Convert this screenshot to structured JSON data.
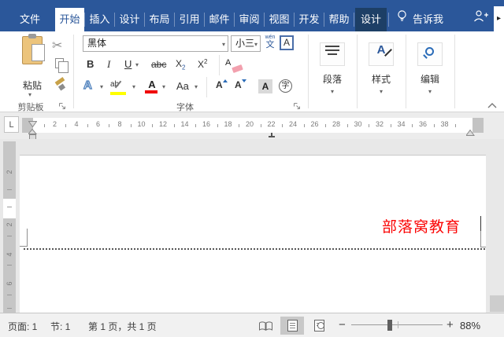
{
  "tabs": [
    {
      "label": "文件"
    },
    {
      "label": "开始"
    },
    {
      "label": "插入"
    },
    {
      "label": "设计"
    },
    {
      "label": "布局"
    },
    {
      "label": "引用"
    },
    {
      "label": "邮件"
    },
    {
      "label": "审阅"
    },
    {
      "label": "视图"
    },
    {
      "label": "开发"
    },
    {
      "label": "帮助"
    },
    {
      "label": "设计"
    }
  ],
  "tell_me": "告诉我",
  "expand_arrow": "▸",
  "ribbon": {
    "paste_label": "粘贴",
    "clipboard_group": "剪贴板",
    "font_group": "字体",
    "font_name": "黑体",
    "font_size": "小三",
    "bold": "B",
    "italic": "I",
    "underline": "U",
    "strikethrough": "abc",
    "sub_x": "X",
    "sub_2": "2",
    "sup_x": "X",
    "sup_2": "2",
    "clear_format": "A",
    "text_effects": "A",
    "highlight": "ab",
    "font_color": "A",
    "change_case": "Aa",
    "grow_font": "A",
    "shrink_font": "A",
    "char_shading": "A",
    "enclose_char": "字",
    "phonetic_top": "wén",
    "phonetic_char": "文",
    "char_border": "A",
    "paragraph": "段落",
    "styles": "样式",
    "styles_a": "A",
    "editing": "编辑",
    "dropdown": "▾"
  },
  "ruler": {
    "tab_selector": "L",
    "numbers": [
      "2",
      "4",
      "6",
      "8",
      "10",
      "12",
      "14",
      "16",
      "18",
      "20",
      "22",
      "24",
      "26",
      "28",
      "30",
      "32",
      "34",
      "36",
      "38"
    ],
    "vertical_numbers": [
      "2",
      "2",
      "4",
      "6"
    ]
  },
  "document": {
    "header_text": "部落窝教育"
  },
  "status": {
    "page": "页面: 1",
    "section": "节: 1",
    "page_of": "第 1 页，共 1 页",
    "zoom_out": "−",
    "zoom_in": "+",
    "zoom": "88%"
  },
  "colors": {
    "accent": "#2b579a",
    "contextual_tab": "#1d3f66",
    "header_text": "#fb0505",
    "highlight": "#ffff00",
    "font_color_bar": "#f00000"
  }
}
